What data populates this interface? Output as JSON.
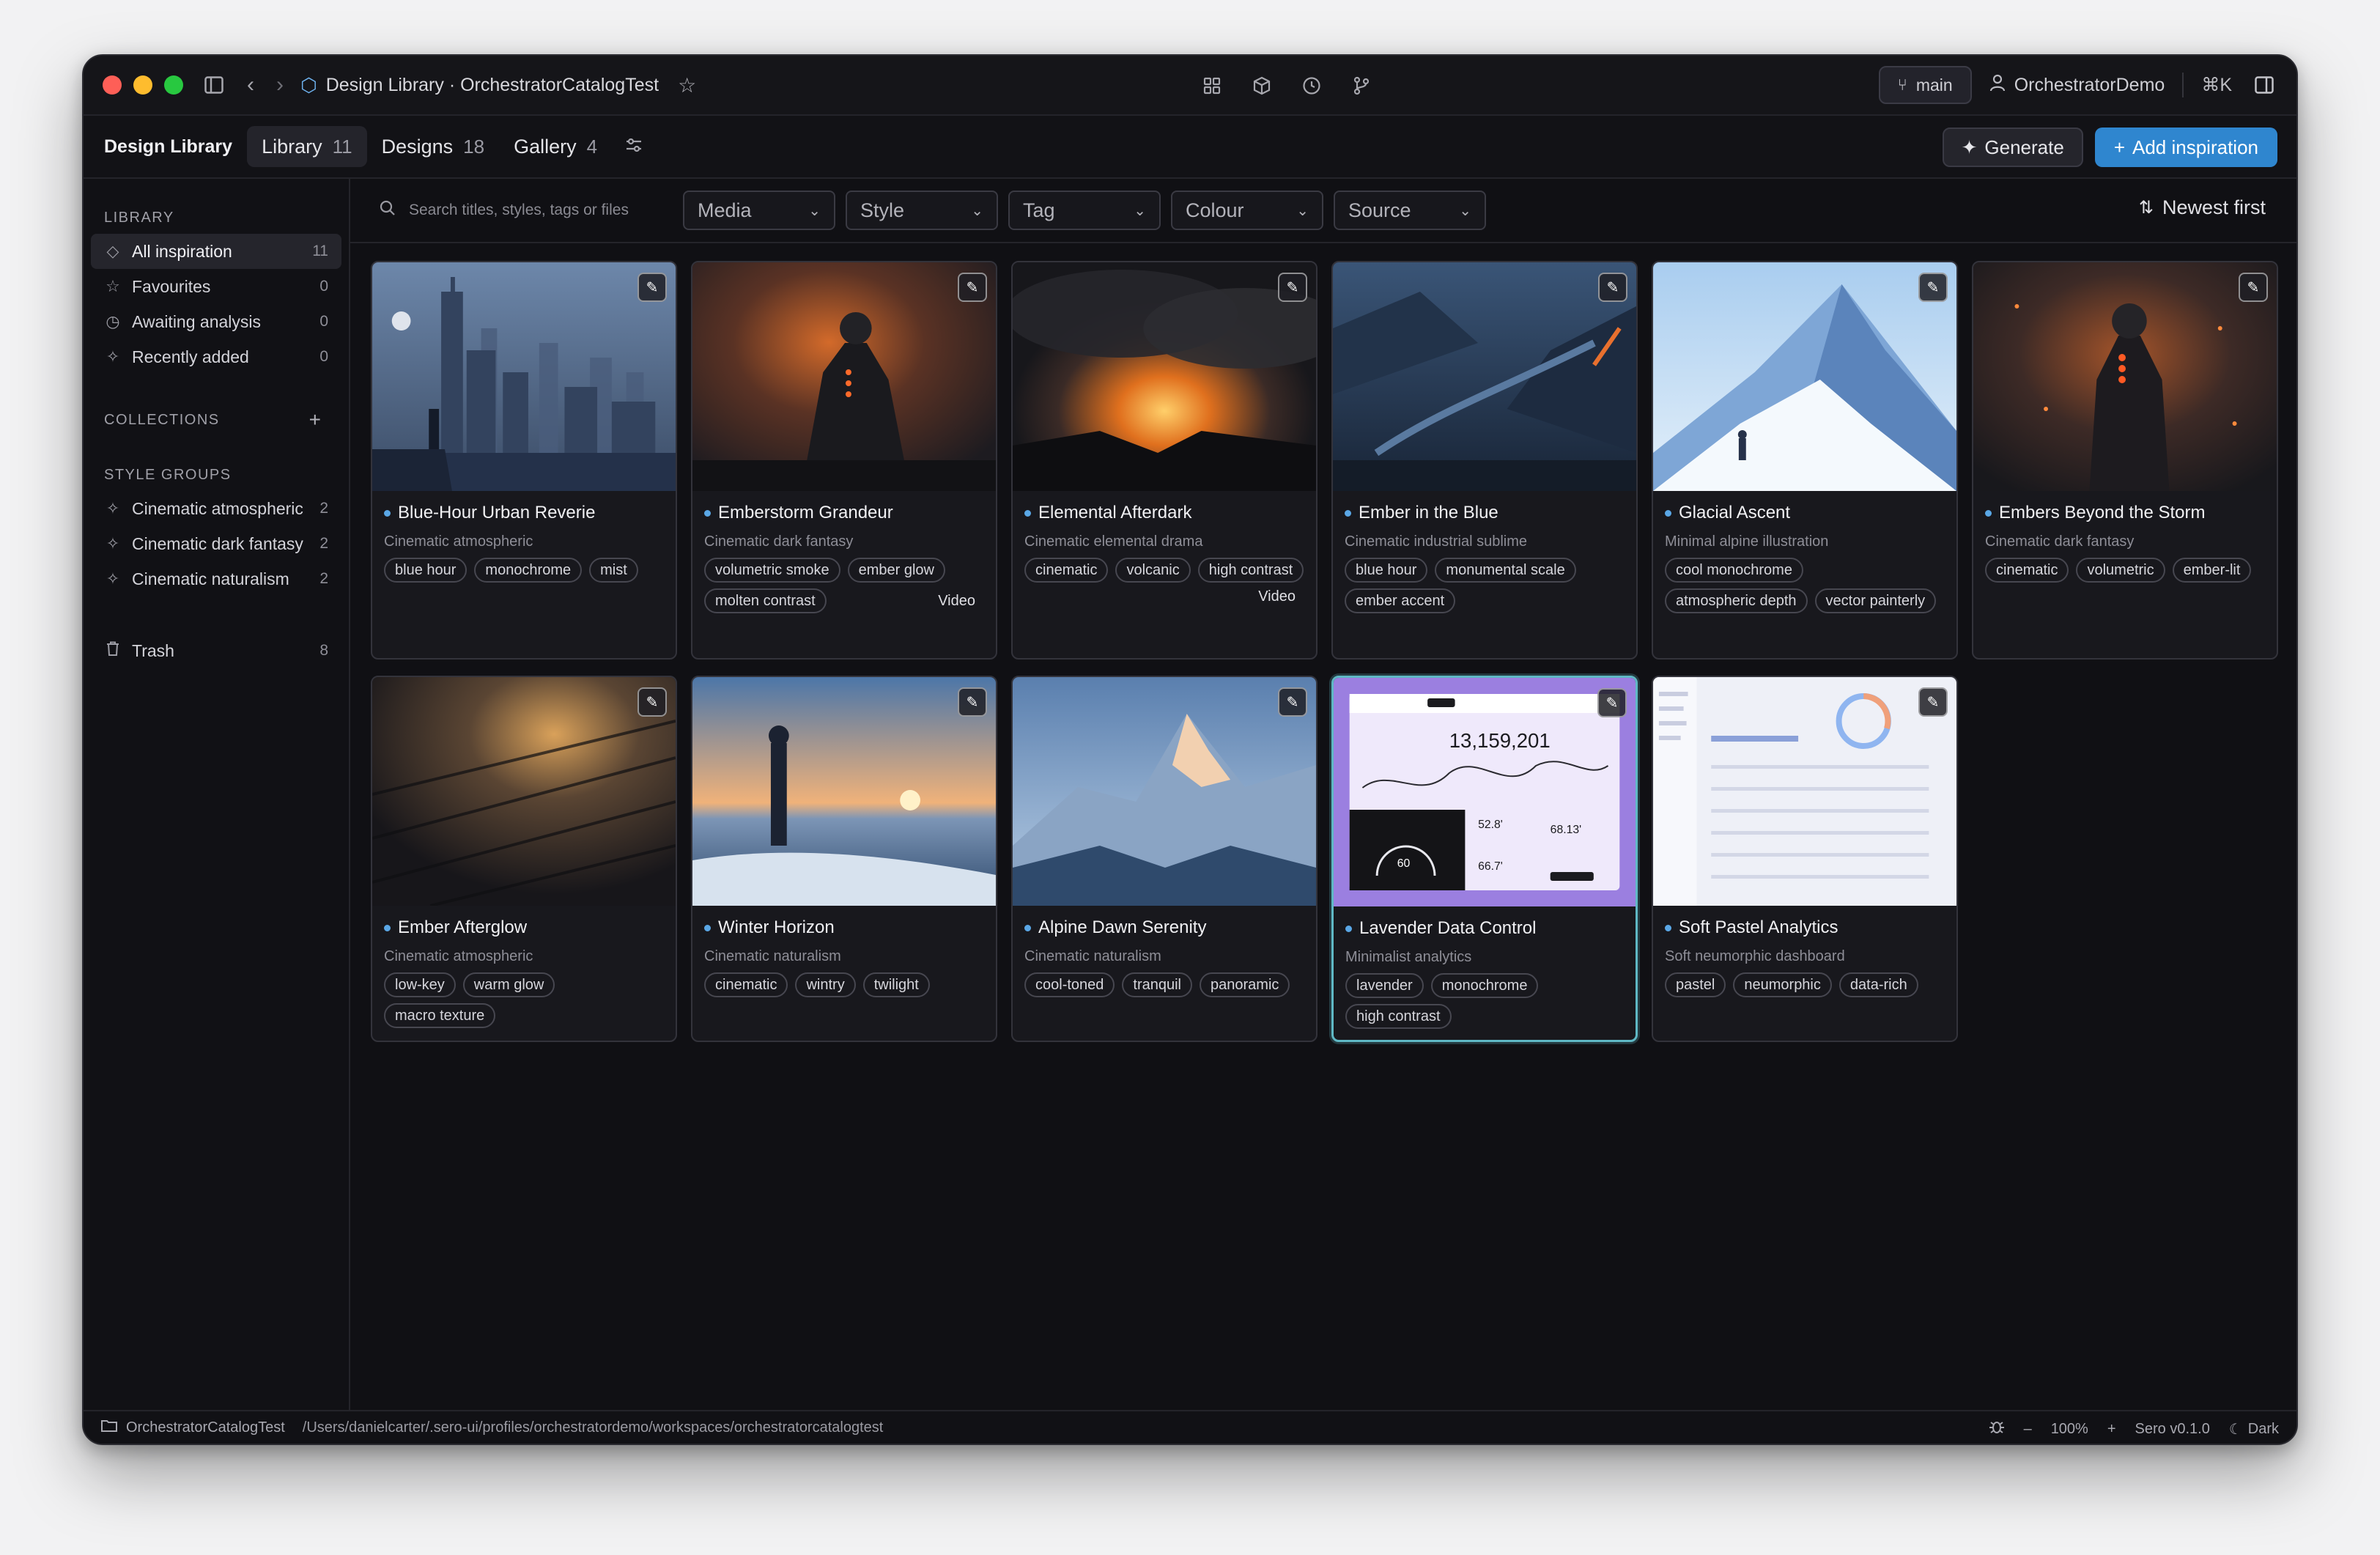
{
  "window": {
    "title": "Design Library · OrchestratorCatalogTest",
    "branch": "main",
    "user": "OrchestratorDemo",
    "shortcut": "⌘K"
  },
  "tabbar": {
    "brand": "Design Library",
    "tabs": [
      {
        "label": "Library",
        "count": "11"
      },
      {
        "label": "Designs",
        "count": "18"
      },
      {
        "label": "Gallery",
        "count": "4"
      }
    ],
    "generate_label": "Generate",
    "add_label": "Add inspiration",
    "accent": "#2f86cf"
  },
  "sidebar": {
    "library_label": "LIBRARY",
    "library_items": [
      {
        "label": "All inspiration",
        "count": "11",
        "icon": "diamond-icon"
      },
      {
        "label": "Favourites",
        "count": "0",
        "icon": "star-icon"
      },
      {
        "label": "Awaiting analysis",
        "count": "0",
        "icon": "clock-icon"
      },
      {
        "label": "Recently added",
        "count": "0",
        "icon": "sparkle-icon"
      }
    ],
    "collections_label": "COLLECTIONS",
    "style_groups_label": "STYLE GROUPS",
    "style_groups": [
      {
        "label": "Cinematic atmospheric",
        "count": "2"
      },
      {
        "label": "Cinematic dark fantasy",
        "count": "2"
      },
      {
        "label": "Cinematic naturalism",
        "count": "2"
      }
    ],
    "trash": {
      "label": "Trash",
      "count": "8"
    }
  },
  "filters": {
    "search_placeholder": "Search titles, styles, tags or files",
    "dropdowns": [
      "Media",
      "Style",
      "Tag",
      "Colour",
      "Source"
    ],
    "sort_label": "Newest first"
  },
  "cards": [
    {
      "title": "Blue-Hour Urban Reverie",
      "style": "Cinematic atmospheric",
      "tags": [
        "blue hour",
        "monochrome",
        "mist"
      ],
      "media": ""
    },
    {
      "title": "Emberstorm Grandeur",
      "style": "Cinematic dark fantasy",
      "tags": [
        "volumetric smoke",
        "ember glow",
        "molten contrast"
      ],
      "media": "Video"
    },
    {
      "title": "Elemental Afterdark",
      "style": "Cinematic elemental drama",
      "tags": [
        "cinematic",
        "volcanic",
        "high contrast"
      ],
      "media": "Video"
    },
    {
      "title": "Ember in the Blue",
      "style": "Cinematic industrial sublime",
      "tags": [
        "blue hour",
        "monumental scale",
        "ember accent"
      ],
      "media": ""
    },
    {
      "title": "Glacial Ascent",
      "style": "Minimal alpine illustration",
      "tags": [
        "cool monochrome",
        "atmospheric depth",
        "vector painterly"
      ],
      "media": ""
    },
    {
      "title": "Embers Beyond the Storm",
      "style": "Cinematic dark fantasy",
      "tags": [
        "cinematic",
        "volumetric",
        "ember-lit"
      ],
      "media": ""
    },
    {
      "title": "Ember Afterglow",
      "style": "Cinematic atmospheric",
      "tags": [
        "low-key",
        "warm glow",
        "macro texture"
      ],
      "media": ""
    },
    {
      "title": "Winter Horizon",
      "style": "Cinematic naturalism",
      "tags": [
        "cinematic",
        "wintry",
        "twilight"
      ],
      "media": ""
    },
    {
      "title": "Alpine Dawn Serenity",
      "style": "Cinematic naturalism",
      "tags": [
        "cool-toned",
        "tranquil",
        "panoramic"
      ],
      "media": ""
    },
    {
      "title": "Lavender Data Control",
      "style": "Minimalist analytics",
      "tags": [
        "lavender",
        "monochrome",
        "high contrast"
      ],
      "media": "",
      "thumb_big_value": "13,159,201",
      "thumb_gauge": "60",
      "thumb_vals": [
        "52.8'",
        "68.13'",
        "66.7'"
      ]
    },
    {
      "title": "Soft Pastel Analytics",
      "style": "Soft neumorphic dashboard",
      "tags": [
        "pastel",
        "neumorphic",
        "data-rich"
      ],
      "media": ""
    }
  ],
  "statusbar": {
    "workspace": "OrchestratorCatalogTest",
    "path": "/Users/danielcarter/.sero-ui/profiles/orchestratordemo/workspaces/orchestratorcatalogtest",
    "zoom": "100%",
    "version": "Sero v0.1.0",
    "theme": "Dark"
  }
}
